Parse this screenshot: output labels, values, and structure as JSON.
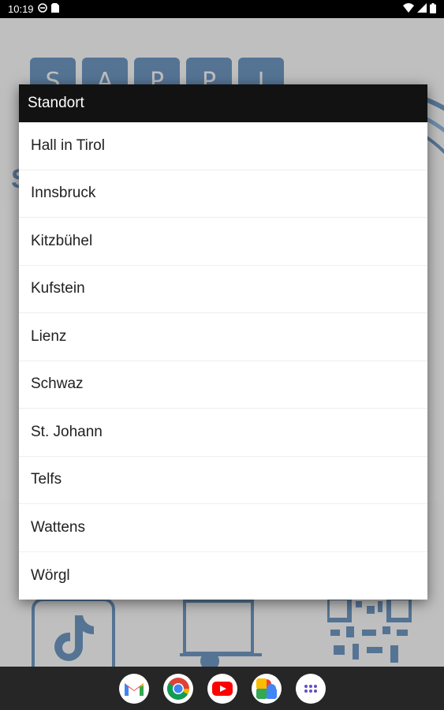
{
  "status_bar": {
    "time": "10:19",
    "left_icons": [
      "dnd-icon",
      "sim-card-icon"
    ],
    "right_icons": [
      "wifi-icon",
      "signal-icon",
      "battery-icon"
    ]
  },
  "background_app": {
    "logo_letters": [
      "S",
      "A",
      "P",
      "P",
      "I"
    ],
    "partial_letter": "S",
    "brand_color": "#2b6aa8"
  },
  "dialog": {
    "title": "Standort",
    "items": [
      {
        "label": "Hall in Tirol"
      },
      {
        "label": "Innsbruck"
      },
      {
        "label": "Kitzbühel"
      },
      {
        "label": "Kufstein"
      },
      {
        "label": "Lienz"
      },
      {
        "label": "Schwaz"
      },
      {
        "label": "St. Johann"
      },
      {
        "label": "Telfs"
      },
      {
        "label": "Wattens"
      },
      {
        "label": "Wörgl"
      }
    ]
  },
  "dock": {
    "apps": [
      "gmail-icon",
      "chrome-icon",
      "youtube-icon",
      "photos-icon",
      "app-drawer-icon"
    ]
  }
}
